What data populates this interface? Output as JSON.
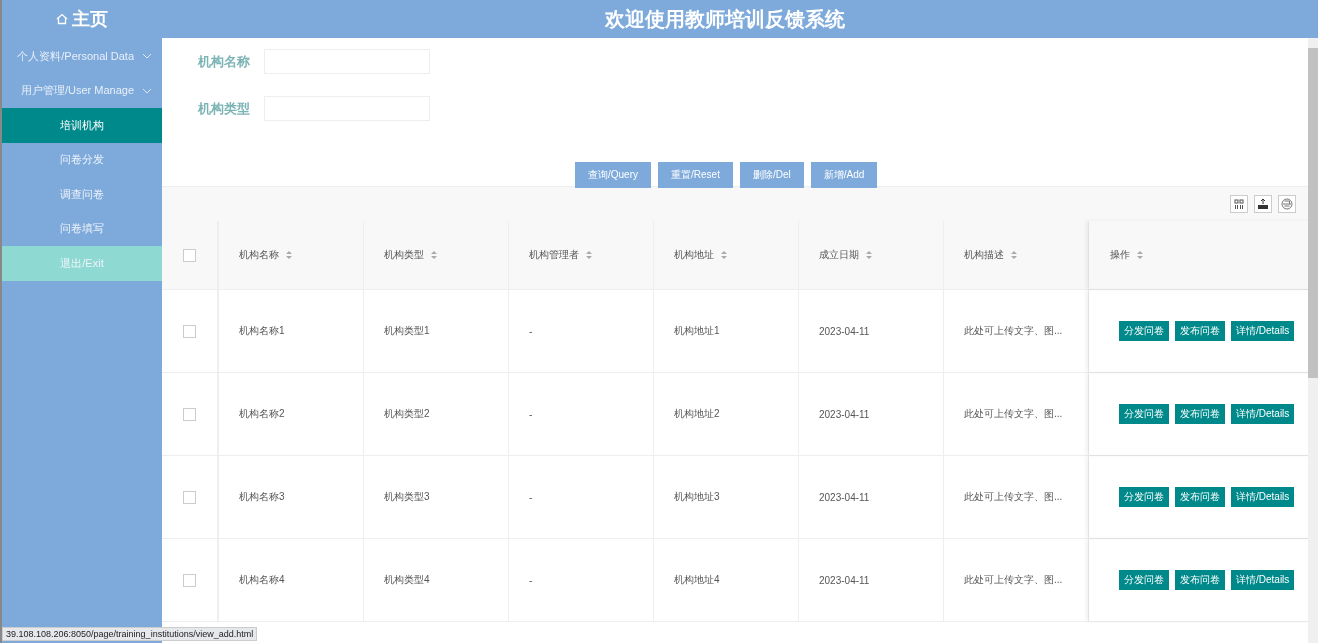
{
  "header": {
    "home": "主页",
    "title": "欢迎使用教师培训反馈系统"
  },
  "sidebar": {
    "items": [
      {
        "label": "个人资料/Personal Data",
        "kind": "group",
        "selected": false
      },
      {
        "label": "用户管理/User Manage",
        "kind": "group",
        "selected": false
      },
      {
        "label": "培训机构",
        "kind": "link",
        "selected": true
      },
      {
        "label": "问卷分发",
        "kind": "link",
        "selected": false
      },
      {
        "label": "调查问卷",
        "kind": "link",
        "selected": false
      },
      {
        "label": "问卷填写",
        "kind": "link",
        "selected": false
      },
      {
        "label": "退出/Exit",
        "kind": "exit",
        "selected": false
      }
    ]
  },
  "filters": [
    {
      "label": "机构名称"
    },
    {
      "label": "机构类型"
    }
  ],
  "actions": [
    "查询/Query",
    "重置/Reset",
    "删除/Del",
    "新增/Add"
  ],
  "table": {
    "all_checked": false,
    "columns": [
      "机构名称",
      "机构类型",
      "机构管理者",
      "机构地址",
      "成立日期",
      "机构描述",
      "操作"
    ],
    "rows": [
      {
        "checked": false,
        "cells": [
          "机构名称1",
          "机构类型1",
          "-",
          "机构地址1",
          "2023-04-11",
          "此处可上传文字、图..."
        ],
        "buttons": [
          "分发问卷",
          "发布问卷",
          "详情/Details"
        ]
      },
      {
        "checked": false,
        "cells": [
          "机构名称2",
          "机构类型2",
          "-",
          "机构地址2",
          "2023-04-11",
          "此处可上传文字、图..."
        ],
        "buttons": [
          "分发问卷",
          "发布问卷",
          "详情/Details"
        ]
      },
      {
        "checked": false,
        "cells": [
          "机构名称3",
          "机构类型3",
          "-",
          "机构地址3",
          "2023-04-11",
          "此处可上传文字、图..."
        ],
        "buttons": [
          "分发问卷",
          "发布问卷",
          "详情/Details"
        ]
      },
      {
        "checked": false,
        "cells": [
          "机构名称4",
          "机构类型4",
          "-",
          "机构地址4",
          "2023-04-11",
          "此处可上传文字、图..."
        ],
        "buttons": [
          "分发问卷",
          "发布问卷",
          "详情/Details"
        ]
      }
    ]
  },
  "status_bar": "39.108.108.206:8050/page/training_institutions/view_add.html"
}
